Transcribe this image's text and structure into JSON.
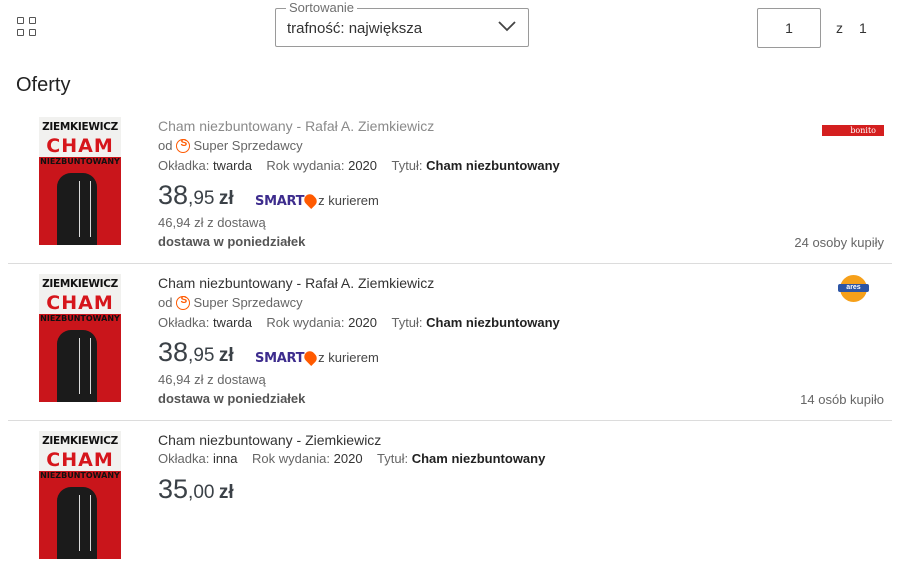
{
  "toolbar": {
    "grid_icon": "grid-view-icon",
    "sort_label": "Sortowanie",
    "sort_value": "trafność: największa",
    "page_current": "1",
    "page_of": "z",
    "page_total": "1"
  },
  "heading": "Oferty",
  "cover": {
    "author": "ZIEMKIEWICZ",
    "title": "CHAM",
    "subtitle": "NIEZBUNTOWANY"
  },
  "offers": [
    {
      "title": "Cham niezbuntowany - Rafał A. Ziemkiewicz",
      "title_color": "#8a8a8a",
      "seller_prefix": "od",
      "seller": "Super Sprzedawcy",
      "cover_label": "Okładka:",
      "cover_value": "twarda",
      "year_label": "Rok wydania:",
      "year_value": "2020",
      "title_label": "Tytuł:",
      "title_value": "Cham niezbuntowany",
      "price_int": "38",
      "price_dec": ",95",
      "price_cur": "zł",
      "smart_logo": "SMART",
      "smart_text": "z kurierem",
      "with_delivery": "46,94 zł z dostawą",
      "delivery": "dostawa w poniedziałek",
      "bought": "24 osoby kupiły",
      "shop_logo": "bonito"
    },
    {
      "title": "Cham niezbuntowany - Rafał A. Ziemkiewicz",
      "title_color": "#333333",
      "seller_prefix": "od",
      "seller": "Super Sprzedawcy",
      "cover_label": "Okładka:",
      "cover_value": "twarda",
      "year_label": "Rok wydania:",
      "year_value": "2020",
      "title_label": "Tytuł:",
      "title_value": "Cham niezbuntowany",
      "price_int": "38",
      "price_dec": ",95",
      "price_cur": "zł",
      "smart_logo": "SMART",
      "smart_text": "z kurierem",
      "with_delivery": "46,94 zł z dostawą",
      "delivery": "dostawa w poniedziałek",
      "bought": "14 osób kupiło",
      "shop_logo": "ares"
    },
    {
      "title": "Cham niezbuntowany - Ziemkiewicz",
      "title_color": "#333333",
      "cover_label": "Okładka:",
      "cover_value": "inna",
      "year_label": "Rok wydania:",
      "year_value": "2020",
      "title_label": "Tytuł:",
      "title_value": "Cham niezbuntowany",
      "price_int": "35",
      "price_dec": ",00",
      "price_cur": "zł"
    }
  ],
  "colors": {
    "accent": "#ff5a00",
    "smart": "#3d2c8d",
    "price": "#3b4147"
  }
}
